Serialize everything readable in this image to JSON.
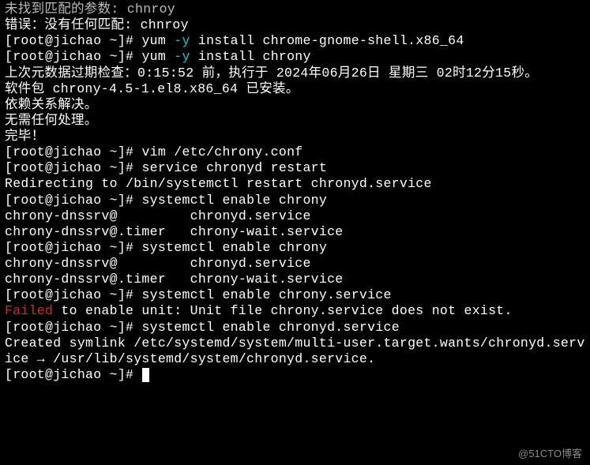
{
  "prompt": {
    "user": "root",
    "host": "jichao",
    "dir": "~",
    "sym": "#"
  },
  "lines": {
    "l0": "未找到匹配的参数: chnroy",
    "l1": "错误：没有任何匹配: chnroy",
    "cmd1a": "yum ",
    "cmd1opt": "-y",
    "cmd1b": " install chrome-gnome-shell.x86_64",
    "cmd2a": "yum ",
    "cmd2opt": "-y",
    "cmd2b": " install chrony",
    "l4": "上次元数据过期检查：0:15:52 前，执行于 2024年06月26日 星期三 02时12分15秒。",
    "l5": "软件包 chrony-4.5-1.el8.x86_64 已安装。",
    "l6": "依赖关系解决。",
    "l7": "无需任何处理。",
    "l8": "完毕！",
    "cmd3": "vim /etc/chrony.conf",
    "cmd4": "service chronyd restart",
    "l9": "Redirecting to /bin/systemctl restart chronyd.service",
    "cmd5": "systemctl enable chrony",
    "l10": "chrony-dnssrv@         chronyd.service",
    "l11": "chrony-dnssrv@.timer   chrony-wait.service",
    "cmd6": "systemctl enable chrony",
    "l12": "chrony-dnssrv@         chronyd.service",
    "l13": "chrony-dnssrv@.timer   chrony-wait.service",
    "cmd7": "systemctl enable chrony.service",
    "fail": "Failed",
    "failrest": " to enable unit: Unit file chrony.service does not exist.",
    "cmd8": "systemctl enable chronyd.service",
    "l15": "Created symlink /etc/systemd/system/multi-user.target.wants/chronyd.service → /usr/lib/systemd/system/chronyd.service.",
    "watermark": "@51CTO博客"
  }
}
